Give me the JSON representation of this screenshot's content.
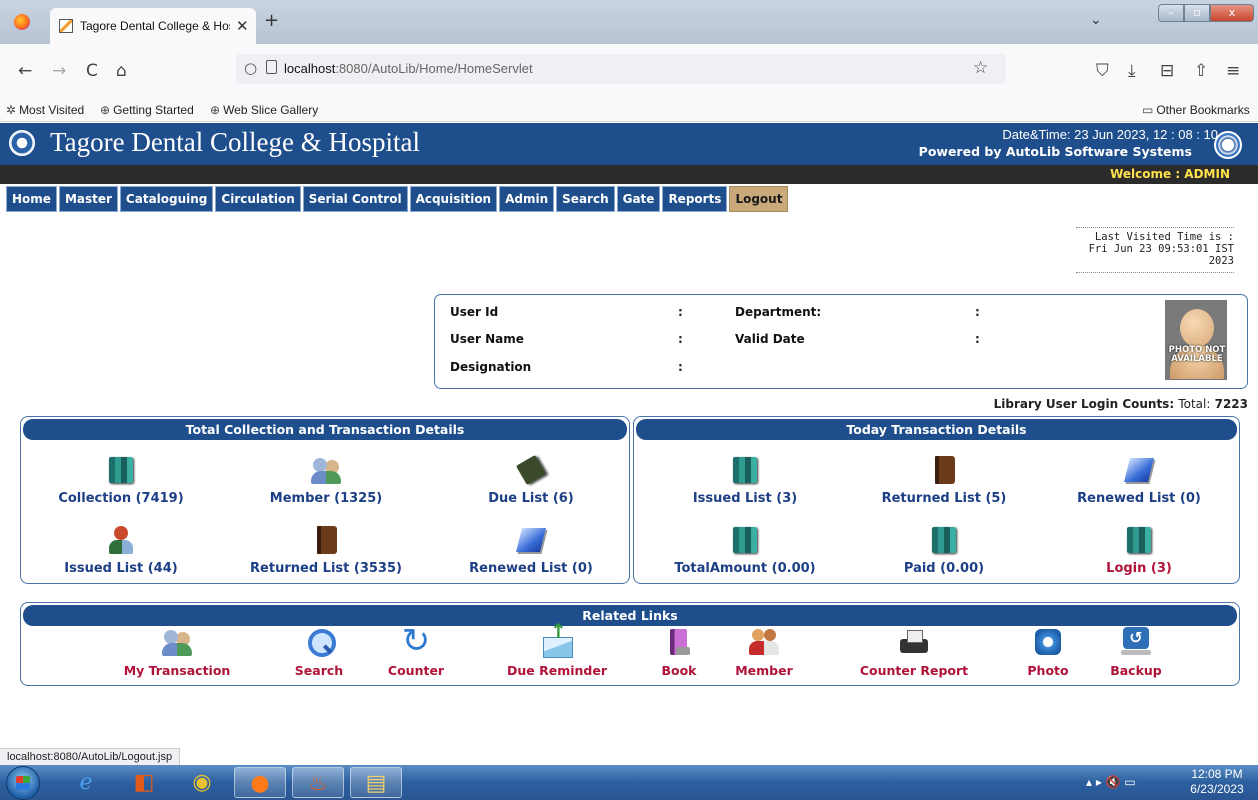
{
  "browser": {
    "tab_title": "Tagore Dental College & Hospit",
    "tab_close": "✕",
    "new_tab": "+",
    "tab_list": "⌄",
    "window_min": "–",
    "window_max": "▫",
    "window_close": "x",
    "back": "←",
    "forward": "→",
    "reload": "C",
    "home": "⌂",
    "url_host": "localhost",
    "url_path": ":8080/AutoLib/Home/HomeServlet",
    "bookmark_star": "☆",
    "pocket": "⛉",
    "downloads": "⤓",
    "library": "⊟",
    "extensions": "⇧",
    "menu": "≡",
    "bookmarks": [
      "Most Visited",
      "Getting Started",
      "Web Slice Gallery"
    ],
    "other_bookmarks": "Other Bookmarks",
    "status_url": "localhost:8080/AutoLib/Logout.jsp"
  },
  "header": {
    "title": "Tagore Dental College & Hospital",
    "datetime": "Date&Time:  23 Jun 2023, 12 : 08 : 10",
    "powered_by": "Powered by AutoLib Software Systems",
    "welcome": "Welcome   :  ADMIN"
  },
  "menu": [
    "Home",
    "Master",
    "Cataloguing",
    "Circulation",
    "Serial Control",
    "Acquisition",
    "Admin",
    "Search",
    "Gate",
    "Reports",
    "Logout"
  ],
  "last_visited": {
    "label": "Last Visited Time is :",
    "line1": "Fri Jun 23 09:53:01 IST",
    "line2": "2023"
  },
  "user_info": {
    "user_id_label": "User Id",
    "user_name_label": "User Name",
    "designation_label": "Designation",
    "department_label": "Department:",
    "valid_date_label": "Valid Date",
    "colon": ":",
    "photo_text": "PHOTO NOT AVAILABLE"
  },
  "login_counts": {
    "label": "Library User Login Counts:",
    "total_label": "Total:",
    "total": "7223"
  },
  "total_panel": {
    "title": "Total Collection and Transaction Details",
    "items": [
      {
        "label": "Collection (7419)",
        "icon": "books-icon"
      },
      {
        "label": "Member (1325)",
        "icon": "members-icon"
      },
      {
        "label": "Due List (6)",
        "icon": "due-book-icon"
      },
      {
        "label": "Issued List (44)",
        "icon": "person-reading-icon"
      },
      {
        "label": "Returned List (3535)",
        "icon": "brown-book-icon"
      },
      {
        "label": "Renewed List (0)",
        "icon": "blue-book-icon"
      }
    ]
  },
  "today_panel": {
    "title": "Today Transaction Details",
    "items": [
      {
        "label": "Issued List (3)",
        "icon": "books-icon"
      },
      {
        "label": "Returned List (5)",
        "icon": "brown-book-icon"
      },
      {
        "label": "Renewed List (0)",
        "icon": "blue-book-icon"
      },
      {
        "label": "TotalAmount (0.00)",
        "icon": "books-icon"
      },
      {
        "label": "Paid (0.00)",
        "icon": "books-icon"
      },
      {
        "label": "Login (3)",
        "icon": "books-icon"
      }
    ]
  },
  "related_links": {
    "title": "Related Links",
    "items": [
      {
        "label": "My Transaction",
        "icon": "my-transaction-icon"
      },
      {
        "label": "Search",
        "icon": "search-icon"
      },
      {
        "label": "Counter",
        "icon": "counter-icon"
      },
      {
        "label": "Due Reminder",
        "icon": "due-reminder-icon"
      },
      {
        "label": "Book",
        "icon": "book-icon"
      },
      {
        "label": "Member",
        "icon": "member-icon"
      },
      {
        "label": "Counter Report",
        "icon": "printer-icon"
      },
      {
        "label": "Photo",
        "icon": "photo-icon"
      },
      {
        "label": "Backup",
        "icon": "backup-icon"
      }
    ]
  },
  "taskbar": {
    "clock_time": "12:08 PM",
    "clock_date": "6/23/2023",
    "tray_icons": "▴  ▸  🔇  ▭"
  }
}
